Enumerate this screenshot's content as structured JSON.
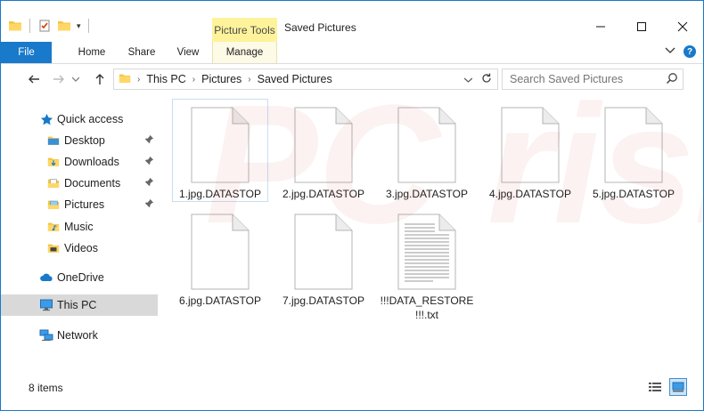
{
  "window": {
    "title": "Saved Pictures",
    "context_tab_group": "Picture Tools",
    "accent": "#1979ca",
    "context_color": "#fef39b"
  },
  "ribbon": {
    "tabs": [
      {
        "label": "File"
      },
      {
        "label": "Home"
      },
      {
        "label": "Share"
      },
      {
        "label": "View"
      },
      {
        "label": "Manage"
      }
    ]
  },
  "address": {
    "segments": [
      "This PC",
      "Pictures",
      "Saved Pictures"
    ]
  },
  "search": {
    "placeholder": "Search Saved Pictures"
  },
  "sidebar": {
    "items": [
      {
        "label": "Quick access",
        "icon": "star-icon",
        "pinned": false
      },
      {
        "label": "Desktop",
        "icon": "folder-icon",
        "pinned": true
      },
      {
        "label": "Downloads",
        "icon": "downloads-folder-icon",
        "pinned": true
      },
      {
        "label": "Documents",
        "icon": "documents-folder-icon",
        "pinned": true
      },
      {
        "label": "Pictures",
        "icon": "pictures-folder-icon",
        "pinned": true
      },
      {
        "label": "Music",
        "icon": "music-folder-icon",
        "pinned": false
      },
      {
        "label": "Videos",
        "icon": "videos-folder-icon",
        "pinned": false
      },
      {
        "label": "OneDrive",
        "icon": "cloud-icon",
        "pinned": false
      },
      {
        "label": "This PC",
        "icon": "computer-icon",
        "pinned": false,
        "selected": true
      },
      {
        "label": "Network",
        "icon": "network-icon",
        "pinned": false
      }
    ]
  },
  "files": [
    {
      "name": "1.jpg.DATASTOP",
      "type": "blank-document",
      "selected": true
    },
    {
      "name": "2.jpg.DATASTOP",
      "type": "blank-document"
    },
    {
      "name": "3.jpg.DATASTOP",
      "type": "blank-document"
    },
    {
      "name": "4.jpg.DATASTOP",
      "type": "blank-document"
    },
    {
      "name": "5.jpg.DATASTOP",
      "type": "blank-document"
    },
    {
      "name": "6.jpg.DATASTOP",
      "type": "blank-document"
    },
    {
      "name": "7.jpg.DATASTOP",
      "type": "blank-document"
    },
    {
      "name": "!!!DATA_RESTORE\n!!!.txt",
      "type": "text-document"
    }
  ],
  "status": {
    "item_count": "8 items"
  },
  "watermark": {
    "text": "PC risk.com"
  }
}
